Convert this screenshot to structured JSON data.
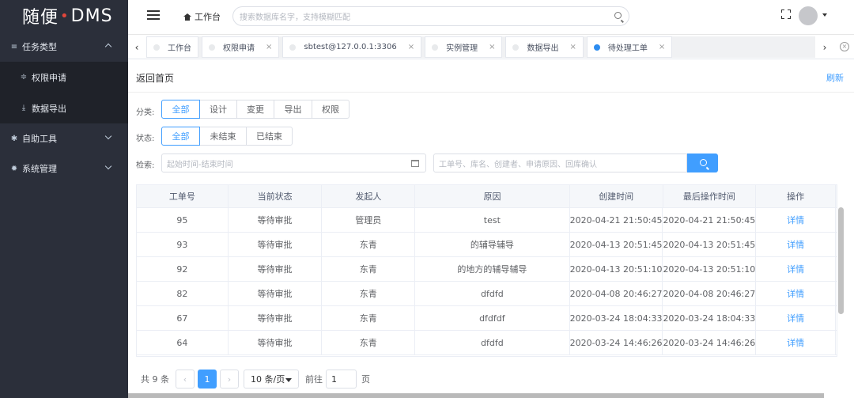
{
  "app": {
    "logo_text_a": "随便",
    "logo_dot": "•",
    "logo_text_b": "DMS"
  },
  "sidebar": {
    "items": [
      {
        "label": "任务类型",
        "icon": "list-icon",
        "expanded": true
      },
      {
        "label": "权限申请",
        "icon": "filter-icon",
        "sub": true
      },
      {
        "label": "数据导出",
        "icon": "download-icon",
        "sub": true
      },
      {
        "label": "自助工具",
        "icon": "tools-icon",
        "expanded": false
      },
      {
        "label": "系统管理",
        "icon": "gear-icon",
        "expanded": false
      }
    ]
  },
  "topbar": {
    "breadcrumb": "工作台",
    "search_placeholder": "搜索数据库名字，支持模糊匹配"
  },
  "tabs": [
    {
      "label": "工作台",
      "closable": false
    },
    {
      "label": "权限申请",
      "closable": true
    },
    {
      "label": "sbtest@127.0.0.1:3306",
      "closable": true
    },
    {
      "label": "实例管理",
      "closable": true
    },
    {
      "label": "数据导出",
      "closable": true
    },
    {
      "label": "待处理工单",
      "closable": true,
      "active": true
    }
  ],
  "tabs_ui": {
    "prev": "‹",
    "next": "›",
    "close_all": "×",
    "close": "×"
  },
  "content": {
    "back_home": "返回首页",
    "refresh": "刷新",
    "category_label": "分类:",
    "categories": [
      "全部",
      "设计",
      "变更",
      "导出",
      "权限"
    ],
    "status_label": "状态:",
    "statuses": [
      "全部",
      "未结束",
      "已结束"
    ],
    "search_label": "检索:",
    "date_placeholder": "起始时间-结束时间",
    "keyword_placeholder": "工单号、库名、创建者、申请原因、回库确认"
  },
  "table": {
    "headers": [
      "工单号",
      "当前状态",
      "发起人",
      "原因",
      "创建时间",
      "最后操作时间",
      "操作"
    ],
    "rows": [
      [
        "95",
        "等待审批",
        "管理员",
        "test",
        "2020-04-21 21:50:45",
        "2020-04-21 21:50:45",
        "详情"
      ],
      [
        "93",
        "等待审批",
        "东青",
        "的辅导辅导",
        "2020-04-13 20:51:45",
        "2020-04-13 20:51:45",
        "详情"
      ],
      [
        "92",
        "等待审批",
        "东青",
        "的地方的辅导辅导",
        "2020-04-13 20:51:10",
        "2020-04-13 20:51:10",
        "详情"
      ],
      [
        "82",
        "等待审批",
        "东青",
        "dfdfd",
        "2020-04-08 20:46:27",
        "2020-04-08 20:46:27",
        "详情"
      ],
      [
        "67",
        "等待审批",
        "东青",
        "dfdfdf",
        "2020-03-24 18:04:33",
        "2020-03-24 18:04:33",
        "详情"
      ],
      [
        "64",
        "等待审批",
        "东青",
        "dfdfd",
        "2020-03-24 14:46:26",
        "2020-03-24 14:46:26",
        "详情"
      ]
    ]
  },
  "pagination": {
    "total": "共 9 条",
    "prev": "‹",
    "current": "1",
    "next": "›",
    "page_size": "10 条/页",
    "goto_label": "前往",
    "goto_value": "1",
    "page_unit": "页"
  }
}
